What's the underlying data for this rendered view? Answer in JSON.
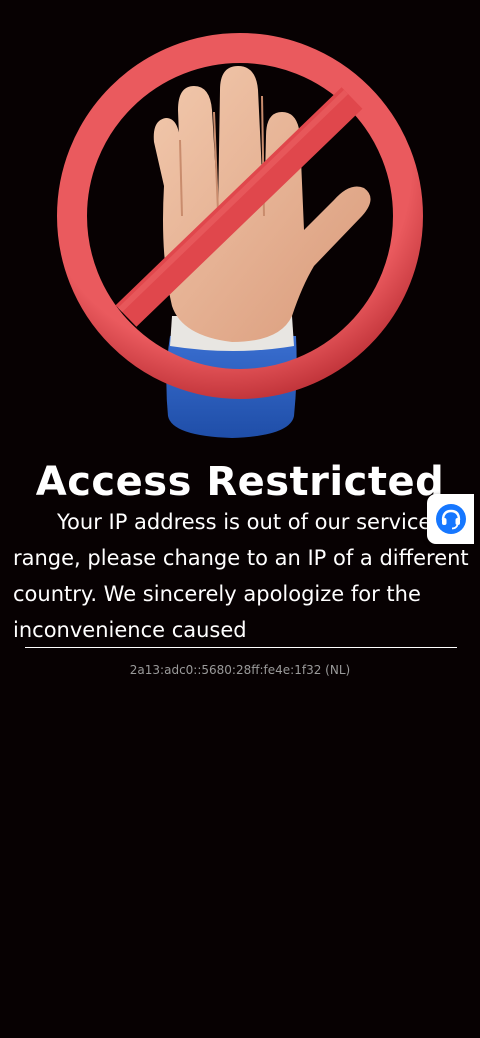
{
  "page": {
    "title": "Access Restricted",
    "message": "Your IP address is out of our service range, please change to an IP of a different country. We sincerely apologize for the inconvenience caused",
    "ip_info": "2a13:adc0::5680:28ff:fe4e:1f32 (NL)"
  },
  "hero": {
    "icon": "stop-hand-prohibited-icon"
  },
  "support_widget": {
    "icon": "headset-support-icon",
    "color": "#1677ff"
  },
  "colors": {
    "background": "#070102",
    "prohibition_red": "#e0474c",
    "text": "#ffffff",
    "ip_text": "#9a9a9a"
  }
}
